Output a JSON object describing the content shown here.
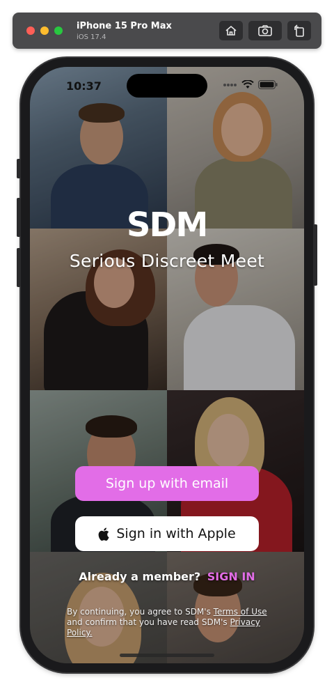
{
  "simulator": {
    "device_name": "iPhone 15 Pro Max",
    "os_version": "iOS 17.4",
    "buttons": [
      "home-icon",
      "screenshot-icon",
      "rotate-icon"
    ]
  },
  "status_bar": {
    "time": "10:37"
  },
  "app": {
    "logo_text": "SDM",
    "tagline": "Serious Discreet Meet",
    "signup_email_label": "Sign up with email",
    "apple_signin_label": "Sign in with Apple",
    "member_prompt": "Already a member?",
    "sign_in_link": "SIGN IN",
    "legal": {
      "part1": "By continuing, you agree to SDM's ",
      "terms_link": "Terms of Use",
      "part2": " and confirm that you have read SDM's ",
      "privacy_link": "Privacy Policy.",
      "part3": ""
    }
  },
  "colors": {
    "accent": "#e26de7",
    "apple_button_bg": "#ffffff",
    "toolbar_bg": "#4a4a4c"
  }
}
